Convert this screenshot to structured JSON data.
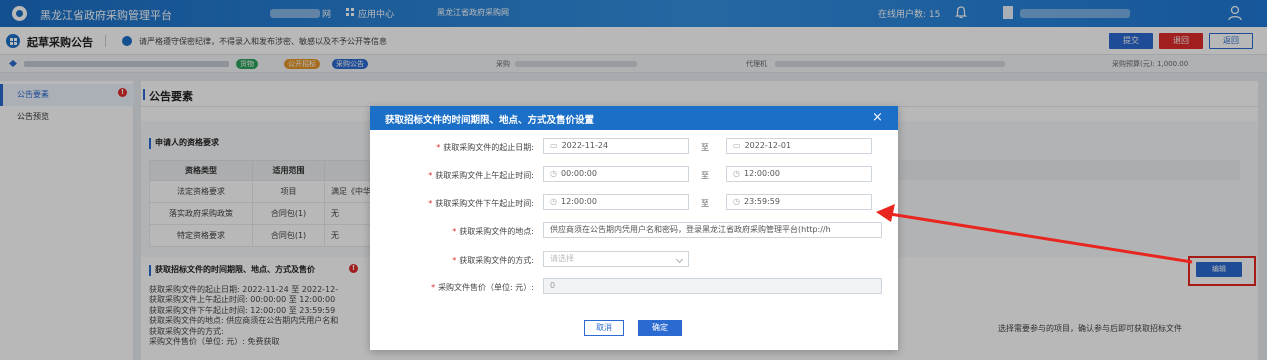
{
  "header": {
    "app_title": "黑龙江省政府采购管理平台",
    "blurred_tail": "网",
    "app_center": "应用中心",
    "site_link": "黑龙江省政府采购网",
    "online_users": "在线用户数: 15"
  },
  "toolbar": {
    "page_title": "起草采购公告",
    "notice": "请严格遵守保密纪律，不得录入和发布涉密、敏感以及不予公开等信息",
    "submit_label": "提交",
    "back_label": "退回",
    "return_label": "返回"
  },
  "info_bar": {
    "tags": [
      "货物",
      "公开招标",
      "采购公告"
    ],
    "purchaser_label": "采购",
    "agent_label": "代理机",
    "budget": "采购预算(元): 1,000.00"
  },
  "sidebar": {
    "items": [
      {
        "label": "公告要素",
        "active": true,
        "alert": "!"
      },
      {
        "label": "公告预览",
        "active": false
      }
    ]
  },
  "main": {
    "title": "公告要素",
    "qual_section_title": "申请人的资格要求",
    "qual_table": {
      "headers": [
        "资格类型",
        "适用范围"
      ],
      "rows": [
        [
          "法定资格要求",
          "项目",
          "满足《中华"
        ],
        [
          "落实政府采购政策",
          "合同包(1)",
          "无"
        ],
        [
          "特定资格要求",
          "合同包(1)",
          "无"
        ]
      ]
    },
    "acq_section_title": "获取招标文件的时间期限、地点、方式及售价",
    "acq_lines": [
      "获取采购文件的起止日期:  2022-11-24 至 2022-12-",
      "获取采购文件上午起止时间:  00:00:00 至 12:00:00",
      "获取采购文件下午起止时间:  12:00:00 至 23:59:59",
      "获取采购文件的地点:  供应商须在公告期内凭用户名和",
      "获取采购文件的方式:",
      "采购文件售价（单位: 元）:  免费获取"
    ],
    "acq_right_text": "选择需要参与的项目，确认参与后即可获取招标文件",
    "edit_button": "编辑"
  },
  "modal": {
    "title": "获取招标文件的时间期限、地点、方式及售价设置",
    "close": "×",
    "to_label": "至",
    "rows": {
      "date": {
        "label": "获取采购文件的起止日期:",
        "from": "2022-11-24",
        "to": "2022-12-01"
      },
      "am": {
        "label": "获取采购文件上午起止时间:",
        "from": "00:00:00",
        "to": "12:00:00"
      },
      "pm": {
        "label": "获取采购文件下午起止时间:",
        "from": "12:00:00",
        "to": "23:59:59"
      },
      "place": {
        "label": "获取采购文件的地点:",
        "value": "供应商须在公告期内凭用户名和密码，登录黑龙江省政府采购管理平台(http://h"
      },
      "method": {
        "label": "获取采购文件的方式:",
        "placeholder": "请选择"
      },
      "price": {
        "label": "采购文件售价（单位: 元）:",
        "value": "0"
      }
    },
    "cancel_label": "取消",
    "ok_label": "确定"
  },
  "colors": {
    "primary": "#1b6fc7",
    "danger": "#e02b2b",
    "highlight": "#e8261f"
  }
}
